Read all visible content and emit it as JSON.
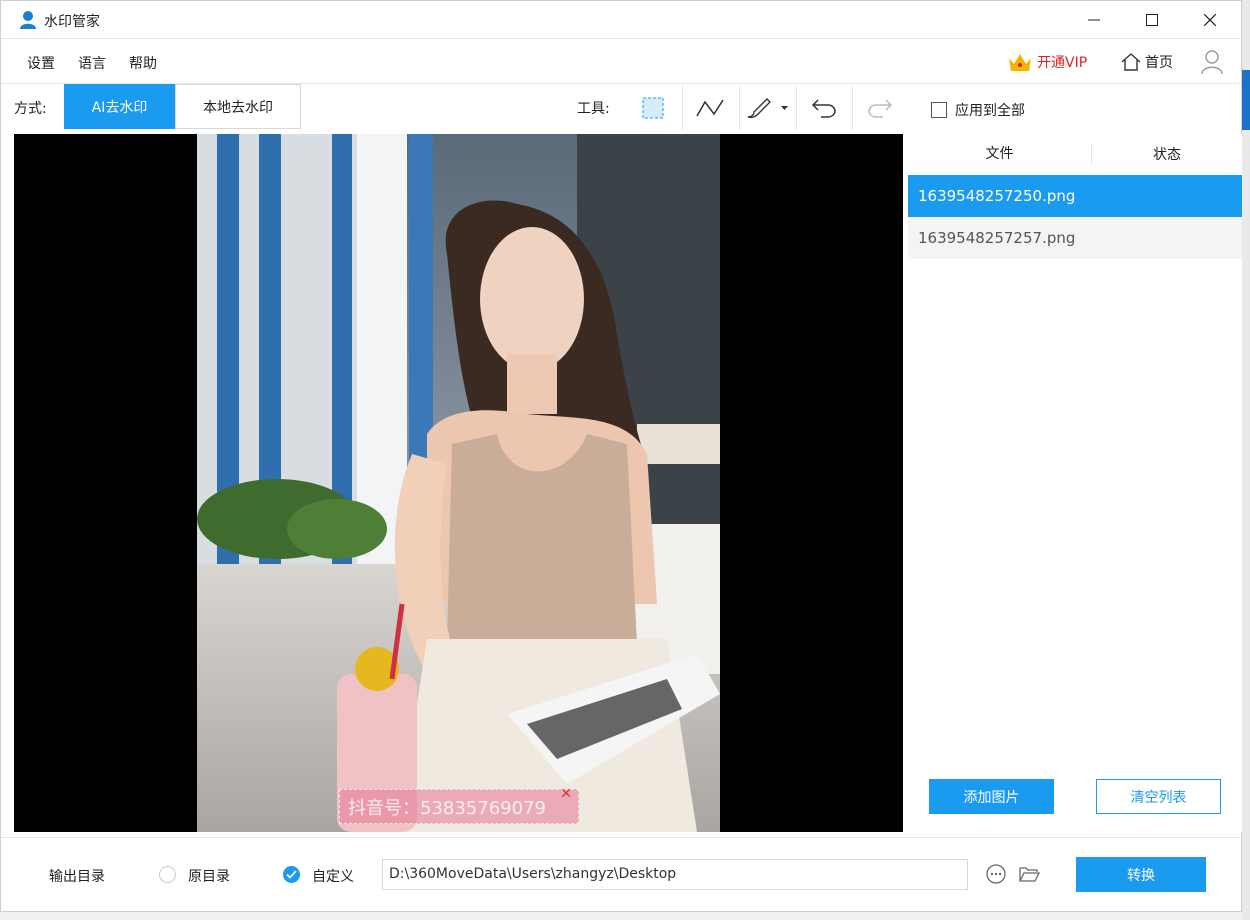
{
  "window": {
    "title": "水印管家"
  },
  "menu": {
    "settings": "设置",
    "language": "语言",
    "help": "帮助"
  },
  "header_right": {
    "vip_label": "开通VIP",
    "home_label": "首页"
  },
  "mode": {
    "label": "方式:",
    "ai": "AI去水印",
    "local": "本地去水印",
    "selected": "AI去水印"
  },
  "tools": {
    "label": "工具:",
    "items": [
      "rect-select-icon",
      "polyline-icon",
      "brush-icon",
      "undo-icon",
      "redo-icon"
    ],
    "apply_all_label": "应用到全部",
    "apply_all_checked": false
  },
  "canvas": {
    "watermark_text": "抖音号：53835769079"
  },
  "file_list": {
    "col_file": "文件",
    "col_status": "状态",
    "rows": [
      {
        "name": "1639548257250.png",
        "status": "",
        "selected": true
      },
      {
        "name": "1639548257257.png",
        "status": "",
        "selected": false
      }
    ],
    "add_button": "添加图片",
    "clear_button": "清空列表"
  },
  "output": {
    "label": "输出目录",
    "option_original": "原目录",
    "option_custom": "自定义",
    "selected": "自定义",
    "path": "D:\\360MoveData\\Users\\zhangyz\\Desktop",
    "convert_button": "转换"
  },
  "colors": {
    "accent": "#1a9bf0",
    "vip": "#e02020"
  }
}
